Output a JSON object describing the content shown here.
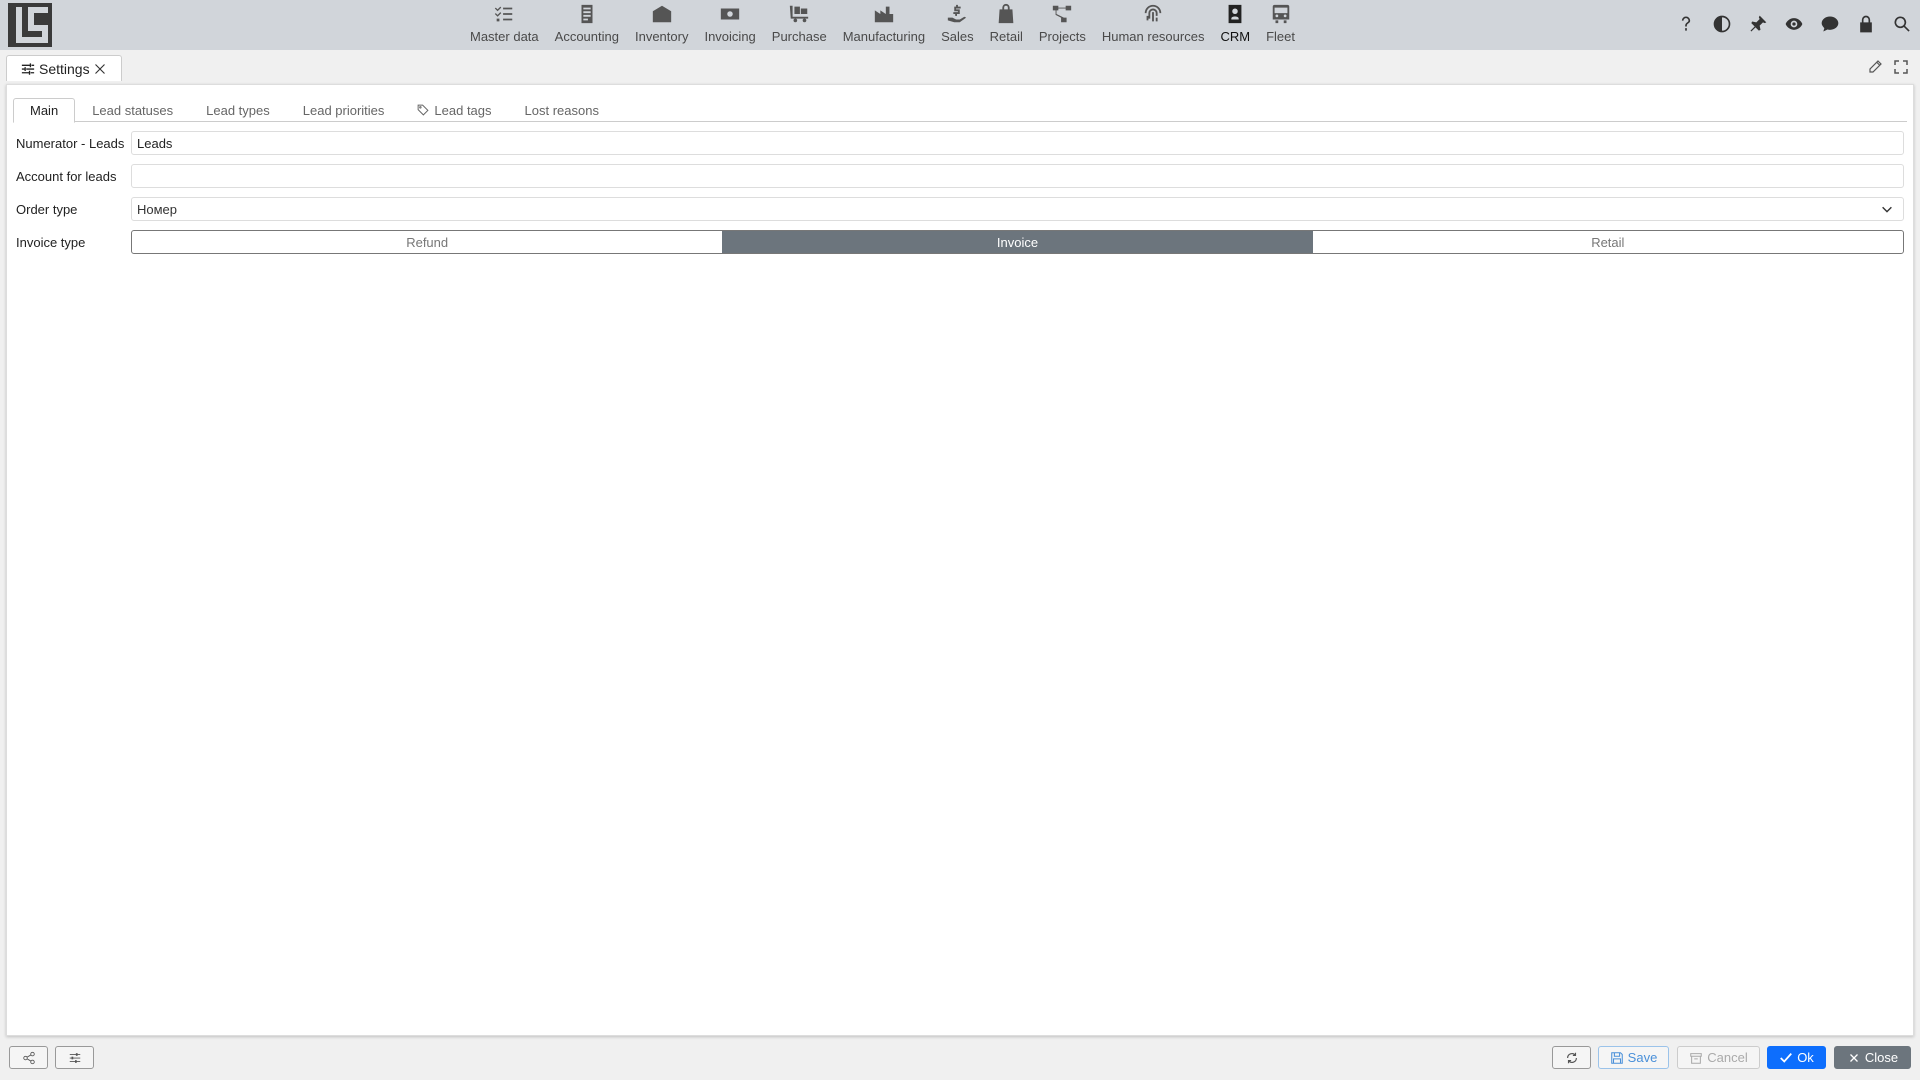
{
  "nav": {
    "modules": [
      {
        "label": "Master data",
        "icon": "checklist-icon"
      },
      {
        "label": "Accounting",
        "icon": "ledger-icon"
      },
      {
        "label": "Inventory",
        "icon": "warehouse-icon"
      },
      {
        "label": "Invoicing",
        "icon": "banknote-icon"
      },
      {
        "label": "Purchase",
        "icon": "dolly-icon"
      },
      {
        "label": "Manufacturing",
        "icon": "factory-icon"
      },
      {
        "label": "Sales",
        "icon": "hand-coin-icon"
      },
      {
        "label": "Retail",
        "icon": "shopping-bag-icon"
      },
      {
        "label": "Projects",
        "icon": "project-tree-icon"
      },
      {
        "label": "Human resources",
        "icon": "fingerprint-icon"
      },
      {
        "label": "CRM",
        "icon": "contact-card-icon",
        "active": true
      },
      {
        "label": "Fleet",
        "icon": "bus-icon"
      }
    ],
    "right_icons": [
      "help-icon",
      "contrast-icon",
      "pin-icon",
      "eye-icon",
      "chat-icon",
      "lock-icon",
      "search-icon"
    ]
  },
  "doc_tab": {
    "label": "Settings"
  },
  "subtabs": [
    {
      "label": "Main",
      "active": true
    },
    {
      "label": "Lead statuses"
    },
    {
      "label": "Lead types"
    },
    {
      "label": "Lead priorities"
    },
    {
      "label": "Lead tags",
      "icon": "tag-icon"
    },
    {
      "label": "Lost reasons"
    }
  ],
  "form": {
    "numerator_label": "Numerator - Leads",
    "numerator_value": "Leads",
    "account_label": "Account for leads",
    "account_value": "",
    "order_type_label": "Order type",
    "order_type_value": "Номер",
    "invoice_type_label": "Invoice type",
    "invoice_type_options": [
      "Refund",
      "Invoice",
      "Retail"
    ],
    "invoice_type_selected": "Invoice"
  },
  "bottom": {
    "save_label": "Save",
    "cancel_label": "Cancel",
    "ok_label": "Ok",
    "close_label": "Close"
  },
  "colors": {
    "accent": "#0d6efd",
    "selected_segment": "#6c757d",
    "topbar": "#d1d5da"
  }
}
